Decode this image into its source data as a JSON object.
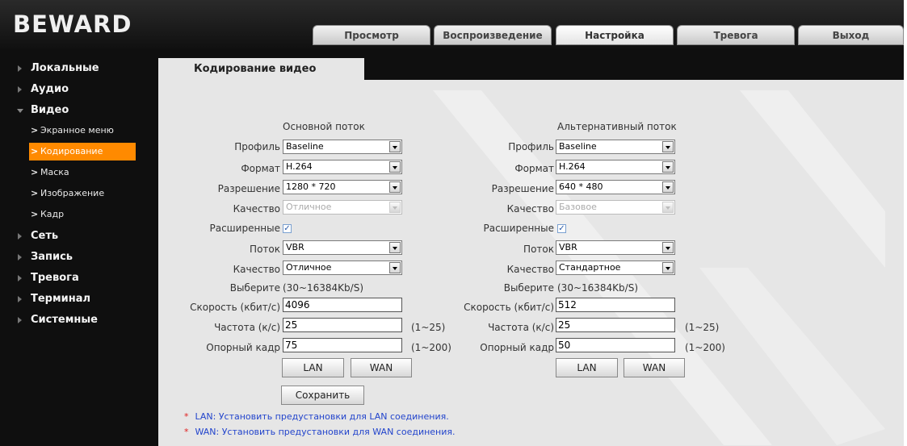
{
  "app": {
    "logo": "BEWARD"
  },
  "nav": {
    "tabs": [
      {
        "label": "Просмотр"
      },
      {
        "label": "Воспроизведение"
      },
      {
        "label": "Настройка"
      },
      {
        "label": "Тревога"
      },
      {
        "label": "Выход"
      }
    ],
    "active_tab": "Настройка"
  },
  "sidebar": {
    "items": [
      {
        "label": "Локальные"
      },
      {
        "label": "Аудио"
      },
      {
        "label": "Видео"
      },
      {
        "label": "Сеть"
      },
      {
        "label": "Запись"
      },
      {
        "label": "Тревога"
      },
      {
        "label": "Терминал"
      },
      {
        "label": "Системные"
      }
    ],
    "video_subitems": [
      {
        "label": "Экранное меню"
      },
      {
        "label": "Кодирование"
      },
      {
        "label": "Маска"
      },
      {
        "label": "Изображение"
      },
      {
        "label": "Кадр"
      }
    ],
    "active_subitem": "Кодирование",
    "accent_color": "#ff8a00"
  },
  "page": {
    "title": "Кодирование видео"
  },
  "labels": {
    "profile": "Профиль",
    "format": "Формат",
    "resolution": "Разрешение",
    "quality": "Качество",
    "advanced": "Расширенные",
    "stream_mode": "Поток",
    "quality2": "Качество",
    "choose": "Выберите",
    "bitrate": "Скорость (кбит/с)",
    "framerate": "Частота (к/с)",
    "keyframe": "Опорный кадр"
  },
  "main_stream": {
    "header": "Основной поток",
    "profile": "Baseline",
    "format": "H.264",
    "resolution": "1280 * 720",
    "quality": "Отличное",
    "advanced_checked": "✓",
    "stream_mode": "VBR",
    "quality2": "Отличное",
    "range": "(30~16384Kb/S)",
    "bitrate": "4096",
    "framerate": "25",
    "framerate_range": "(1~25)",
    "keyframe": "75",
    "keyframe_range": "(1~200)",
    "lan_button": "LAN",
    "wan_button": "WAN"
  },
  "alt_stream": {
    "header": "Альтернативный поток",
    "profile": "Baseline",
    "format": "H.264",
    "resolution": "640 * 480",
    "quality": "Базовое",
    "advanced_checked": "✓",
    "stream_mode": "VBR",
    "quality2": "Стандартное",
    "range": "(30~16384Kb/S)",
    "bitrate": "512",
    "framerate": "25",
    "framerate_range": "(1~25)",
    "keyframe": "50",
    "keyframe_range": "(1~200)",
    "lan_button": "LAN",
    "wan_button": "WAN"
  },
  "actions": {
    "save": "Сохранить"
  },
  "notes": [
    {
      "star": "*",
      "text": "LAN: Установить предустановки для LAN соединения."
    },
    {
      "star": "*",
      "text": "WAN: Установить предустановки для WAN соединения."
    }
  ]
}
